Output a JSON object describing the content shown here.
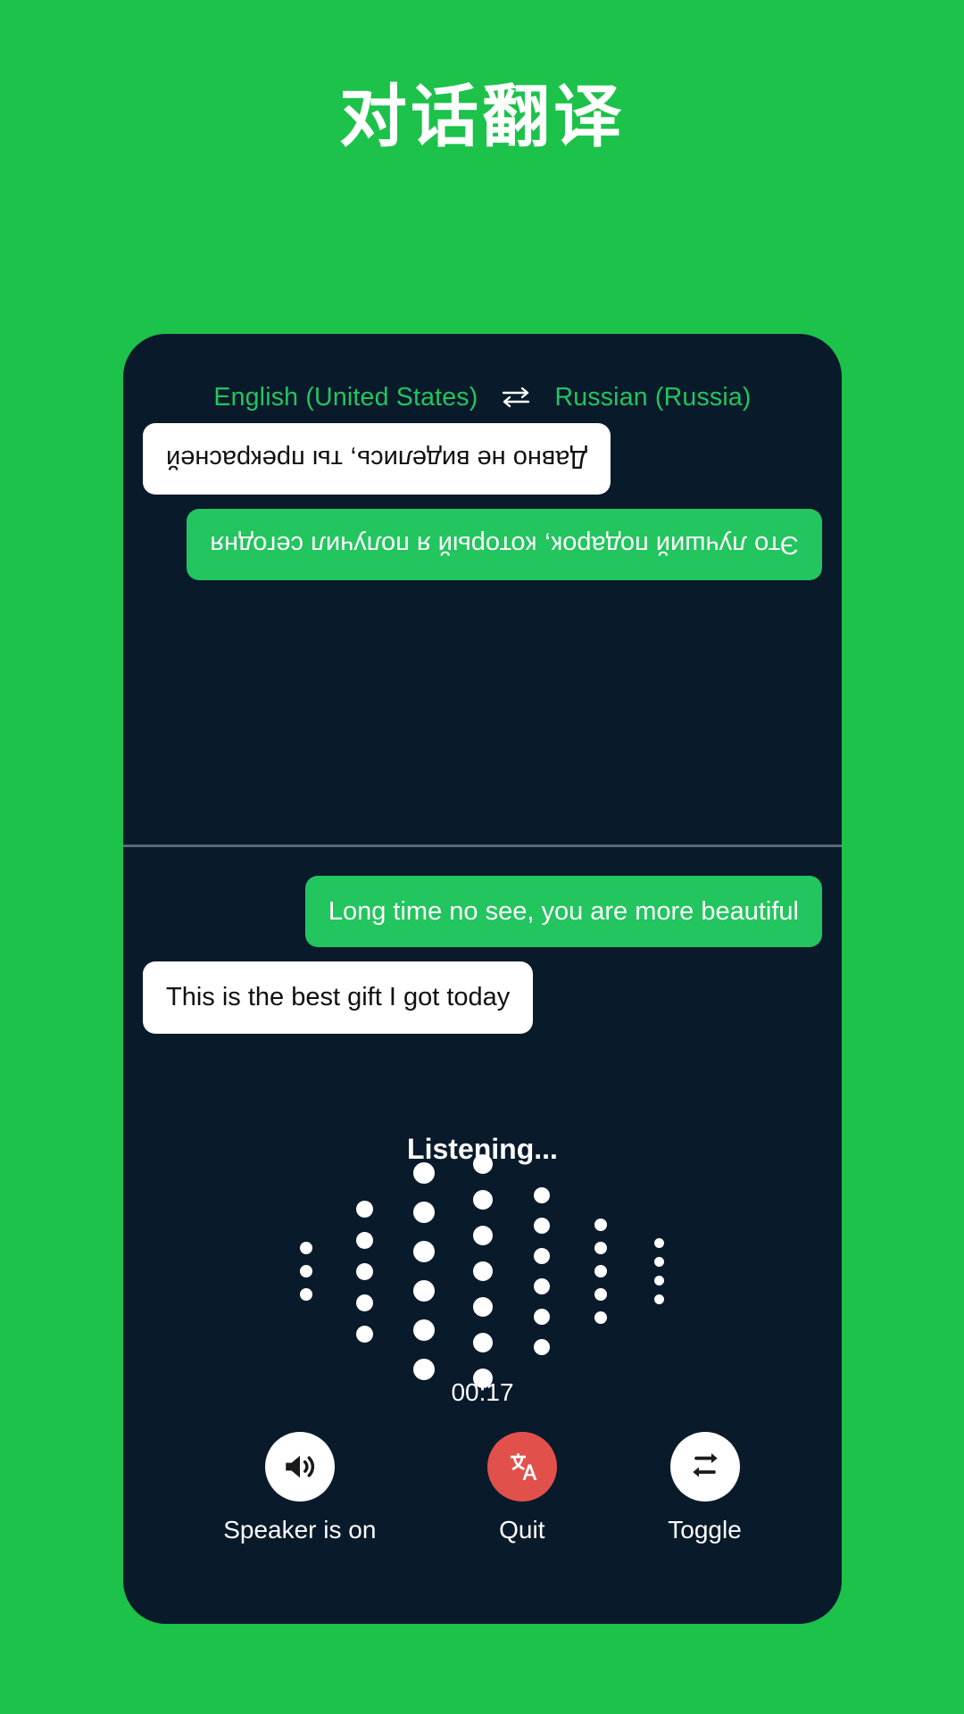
{
  "header": {
    "title": "对话翻译"
  },
  "theme": {
    "page_background": "#1CC24A",
    "card_background": "#091A2B",
    "accent_green": "#22C55E",
    "quit_red": "#E2504B",
    "bubble_white": "#FFFFFF",
    "divider": "#5B6878"
  },
  "languages": {
    "source": "English (United States)",
    "target": "Russian (Russia)",
    "swap_icon": "swap-horizontal-icon"
  },
  "conversation": {
    "top_panel_rotated": true,
    "top_messages": [
      {
        "text": "Это лучший подарок, который я получил сегодня",
        "style": "green",
        "align": "left"
      },
      {
        "text": "Давно не виделись, ты прекрасней",
        "style": "white",
        "align": "right"
      }
    ],
    "bottom_messages": [
      {
        "text": "Long time no see, you are more beautiful",
        "style": "green",
        "align": "right"
      },
      {
        "text": "This is the best gift I got today",
        "style": "white",
        "align": "left"
      }
    ]
  },
  "status": {
    "listening_label": "Listening...",
    "timer": "00:17"
  },
  "waveform": {
    "dot_color": "#FFFFFF",
    "columns": [
      {
        "count": 3,
        "size": 14
      },
      {
        "count": 5,
        "size": 19
      },
      {
        "count": 6,
        "size": 24
      },
      {
        "count": 7,
        "size": 22
      },
      {
        "count": 6,
        "size": 18
      },
      {
        "count": 5,
        "size": 14
      },
      {
        "count": 4,
        "size": 11
      }
    ]
  },
  "controls": [
    {
      "label": "Speaker is on",
      "icon": "speaker-volume-icon",
      "circle": "white"
    },
    {
      "label": "Quit",
      "icon": "translate-icon",
      "circle": "red"
    },
    {
      "label": "Toggle",
      "icon": "swap-repeat-icon",
      "circle": "white"
    }
  ]
}
